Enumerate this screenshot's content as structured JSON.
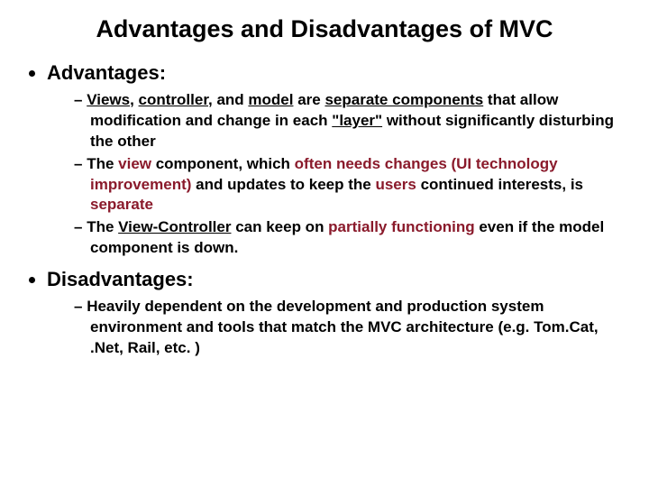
{
  "title": "Advantages and Disadvantages of MVC",
  "list": {
    "adv": {
      "heading": "Advantages:",
      "items": {
        "a1": {
          "views": "Views",
          "controller": "controller",
          "t1": ", ",
          "t2": ", and ",
          "model": "model",
          "t3": " are ",
          "sep": "separate components",
          "t4": " that allow modification and change in each ",
          "layer": "\"layer\"",
          "t5": " without significantly disturbing the other"
        },
        "a2": {
          "t1": "The ",
          "view": "view",
          "t2": " component, which ",
          "often": "often needs changes (UI technology improvement)",
          "t3": " and updates to keep the ",
          "users": "users",
          "t4": " continued interests, is ",
          "sep": "separate"
        },
        "a3": {
          "t1": "The ",
          "vc": "View-Controller",
          "t2": " can keep on ",
          "pf": "partially functioning",
          "t3": " even if the model component is down."
        }
      }
    },
    "disadv": {
      "heading": "Disadvantages:",
      "items": {
        "d1": "Heavily dependent on the development and production system environment and tools that match the MVC architecture (e.g. Tom.Cat, .Net, Rail, etc. )"
      }
    }
  }
}
